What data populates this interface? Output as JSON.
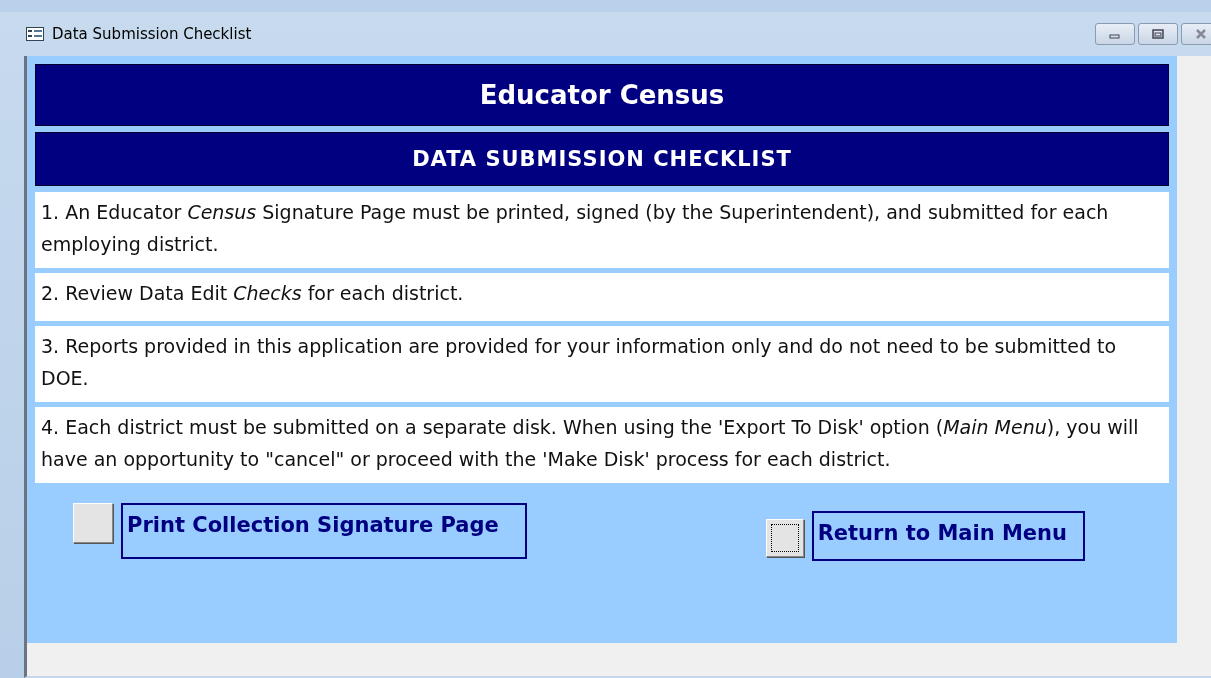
{
  "window": {
    "title": "Data Submission Checklist"
  },
  "header": {
    "title": "Educator Census",
    "subtitle": "DATA SUBMISSION CHECKLIST"
  },
  "checklist": [
    {
      "text": "1.  An Educator *Census* Signature Page must be printed, signed (by the Superintendent), and submitted for each employing district."
    },
    {
      "text": "2. Review Data Edit *Checks* for each district."
    },
    {
      "text": "3.  Reports provided in this application are provided for your information only and do not need to be submitted to DOE."
    },
    {
      "text": "4.  Each district must be submitted on a separate disk.  When using the 'Export To  Disk' option (*Main Menu*),   you will have an opportunity to \"cancel\" or proceed with the 'Make Disk' process for each district."
    }
  ],
  "actions": [
    {
      "label": "Print Collection Signature Page",
      "focused": false
    },
    {
      "label": "Return to Main Menu",
      "focused": true
    }
  ]
}
